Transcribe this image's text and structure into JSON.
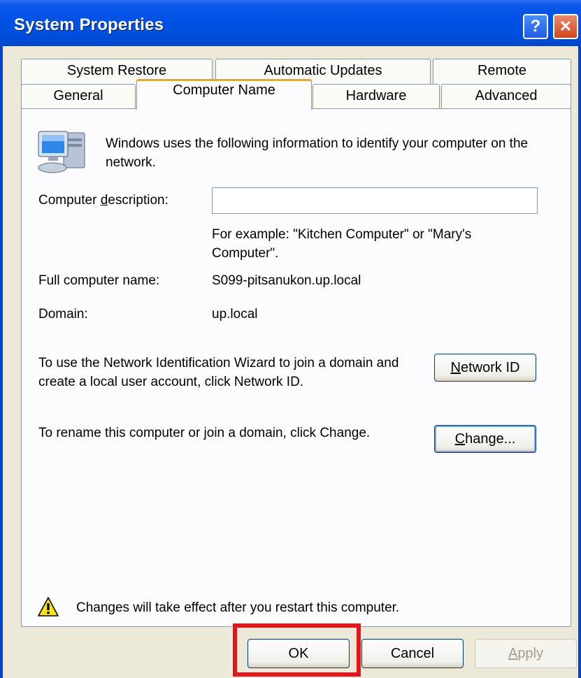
{
  "window": {
    "title": "System Properties",
    "help_glyph": "?",
    "close_glyph": "✕"
  },
  "tabs": {
    "row1": [
      "System Restore",
      "Automatic Updates",
      "Remote"
    ],
    "row2": [
      "General",
      "Computer Name",
      "Hardware",
      "Advanced"
    ],
    "active": "Computer Name"
  },
  "panel": {
    "icon": "computer-icon",
    "intro": "Windows uses the following information to identify your computer on the network.",
    "description_label_pre": "Computer ",
    "description_label_u": "d",
    "description_label_post": "escription:",
    "description_value": "",
    "example": "For example: \"Kitchen Computer\" or \"Mary's Computer\".",
    "full_name_label": "Full computer name:",
    "full_name_value": "S099-pitsanukon.up.local",
    "domain_label": "Domain:",
    "domain_value": "up.local",
    "wizard_text": "To use the Network Identification Wizard to join a domain and create a local user account, click Network ID.",
    "network_id_u": "N",
    "network_id_rest": "etwork ID",
    "rename_text": "To rename this computer or join a domain, click Change.",
    "change_u": "C",
    "change_rest": "hange...",
    "warning_icon": "warning-icon",
    "warning_text": "Changes will take effect after you restart this computer."
  },
  "footer": {
    "ok_label": "OK",
    "cancel_label": "Cancel",
    "apply_u": "A",
    "apply_rest": "pply"
  },
  "colors": {
    "titlebar": "#0050e0",
    "tab_highlight": "#f5a800",
    "highlight_box": "#e3161b"
  }
}
